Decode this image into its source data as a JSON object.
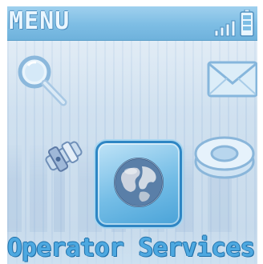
{
  "header": {
    "title": "MENU"
  },
  "status": {
    "signal_icon": "signal-strength-icon",
    "battery_icon": "battery-icon"
  },
  "menu": {
    "items": [
      {
        "icon": "search-icon"
      },
      {
        "icon": "mail-icon"
      },
      {
        "icon": "tools-icon"
      },
      {
        "icon": "settings-icon"
      },
      {
        "icon": "globe-icon",
        "selected": true
      }
    ],
    "selected_label": "Operator Services"
  },
  "colors": {
    "title_bar": "#7dbde4",
    "selection_border": "#2e86c4",
    "label_text": "#4da8e0"
  }
}
